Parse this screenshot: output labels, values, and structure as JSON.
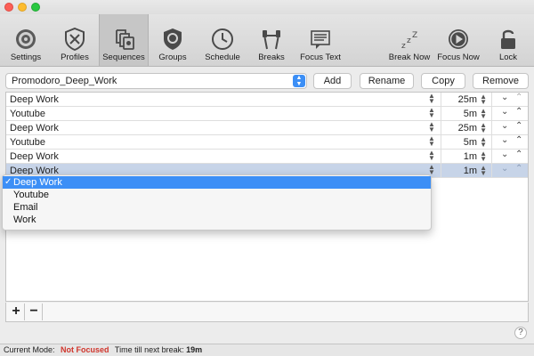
{
  "toolbar": {
    "items": [
      {
        "label": "Settings",
        "icon": "gear-icon"
      },
      {
        "label": "Profiles",
        "icon": "shield-icon"
      },
      {
        "label": "Sequences",
        "icon": "sequences-icon"
      },
      {
        "label": "Groups",
        "icon": "badge-icon"
      },
      {
        "label": "Schedule",
        "icon": "clock-icon"
      },
      {
        "label": "Breaks",
        "icon": "dumbbell-icon"
      },
      {
        "label": "Focus Text",
        "icon": "text-icon"
      },
      {
        "label": "Break Now",
        "icon": "sleep-icon"
      },
      {
        "label": "Focus Now",
        "icon": "play-icon"
      },
      {
        "label": "Lock",
        "icon": "lock-icon"
      }
    ],
    "selected": "Sequences"
  },
  "sequence": {
    "selected": "Promodoro_Deep_Work",
    "buttons": {
      "add": "Add",
      "rename": "Rename",
      "copy": "Copy",
      "remove": "Remove"
    }
  },
  "rows": [
    {
      "name": "Deep Work",
      "duration": "25m"
    },
    {
      "name": "Youtube",
      "duration": "5m"
    },
    {
      "name": "Deep Work",
      "duration": "25m"
    },
    {
      "name": "Youtube",
      "duration": "5m"
    },
    {
      "name": "Deep Work",
      "duration": "1m"
    },
    {
      "name": "Deep Work",
      "duration": "1m"
    }
  ],
  "dropdown": {
    "options": [
      "Deep Work",
      "Youtube",
      "Email",
      "Work"
    ],
    "checked": "Deep Work"
  },
  "bottom": {
    "plus": "+",
    "minus": "−",
    "help": "?"
  },
  "status": {
    "label": "Current Mode:",
    "mode": "Not Focused",
    "next_label": "Time till next break:",
    "next_value": "19m"
  },
  "colors": {
    "accent": "#3c8ff6",
    "mode": "#d0352c"
  }
}
